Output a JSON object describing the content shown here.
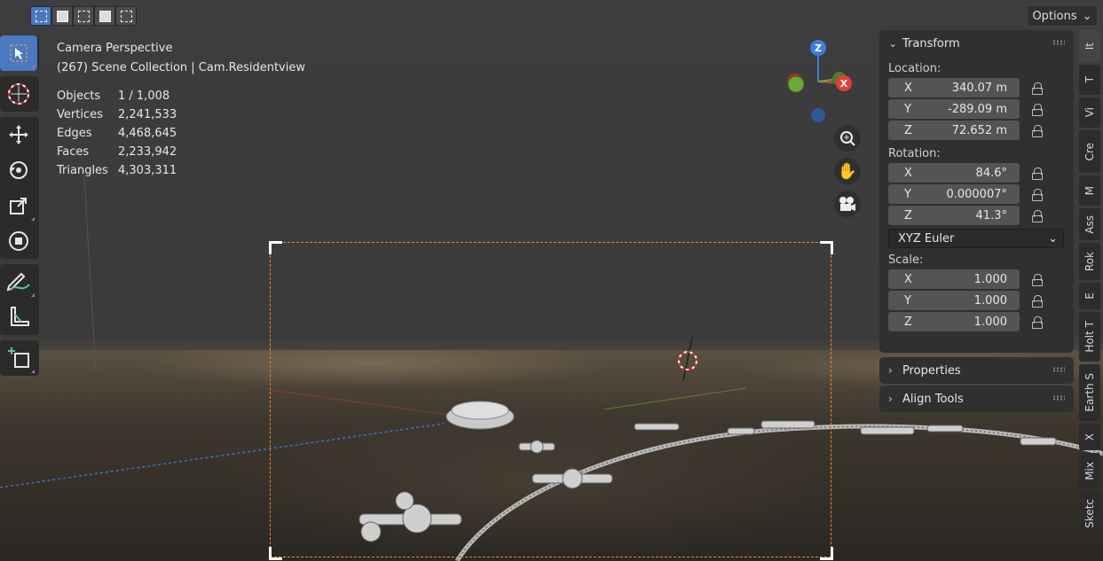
{
  "header": {
    "options_label": "Options"
  },
  "overlay": {
    "view_name": "Camera Perspective",
    "collection": "(267) Scene Collection | Cam.Residentview",
    "stats": [
      {
        "label": "Objects",
        "value": "1 / 1,008"
      },
      {
        "label": "Vertices",
        "value": "2,241,533"
      },
      {
        "label": "Edges",
        "value": "4,468,645"
      },
      {
        "label": "Faces",
        "value": "2,233,942"
      },
      {
        "label": "Triangles",
        "value": "4,303,311"
      }
    ]
  },
  "gizmo": {
    "z": "Z",
    "x": "X"
  },
  "transform": {
    "title": "Transform",
    "location_label": "Location:",
    "location": [
      {
        "axis": "X",
        "value": "340.07 m"
      },
      {
        "axis": "Y",
        "value": "-289.09 m"
      },
      {
        "axis": "Z",
        "value": "72.652 m"
      }
    ],
    "rotation_label": "Rotation:",
    "rotation": [
      {
        "axis": "X",
        "value": "84.6°"
      },
      {
        "axis": "Y",
        "value": "0.000007°"
      },
      {
        "axis": "Z",
        "value": "41.3°"
      }
    ],
    "rotation_mode": "XYZ Euler",
    "scale_label": "Scale:",
    "scale": [
      {
        "axis": "X",
        "value": "1.000"
      },
      {
        "axis": "Y",
        "value": "1.000"
      },
      {
        "axis": "Z",
        "value": "1.000"
      }
    ]
  },
  "panels": {
    "properties": "Properties",
    "align_tools": "Align Tools"
  },
  "side_tabs": [
    "It",
    "T",
    "Vi",
    "Cre",
    "M",
    "Ass",
    "Rok",
    "E",
    "Holt T",
    "Earth S",
    "X",
    "Mix",
    "Sketc"
  ],
  "colors": {
    "accent": "#4a78c2",
    "camera_frame": "#e08a3a",
    "axis_x": "#e0403a",
    "axis_y": "#6ea83a",
    "axis_z": "#3d7fd8"
  }
}
